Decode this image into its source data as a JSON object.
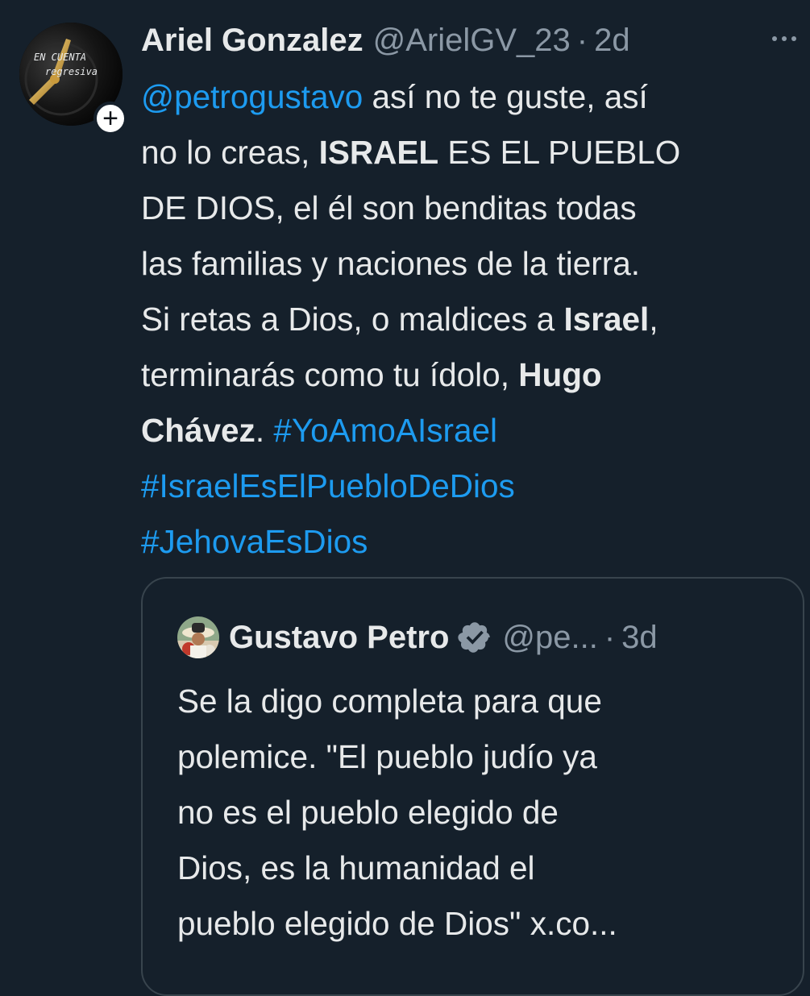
{
  "tweet": {
    "author_name": "Ariel Gonzalez",
    "author_handle": "@ArielGV_23",
    "separator": "·",
    "time": "2d",
    "avatar_text_line1": "EN CUENTA",
    "avatar_text_line2": "regresiva",
    "follow_symbol": "+",
    "lines": [
      [
        {
          "t": "@petrogustavo",
          "s": "link"
        },
        {
          "t": " así no te guste, así",
          "s": "normal"
        }
      ],
      [
        {
          "t": "no lo creas, ",
          "s": "normal"
        },
        {
          "t": "ISRAEL",
          "s": "bold"
        },
        {
          "t": " ES EL PUEBLO",
          "s": "normal"
        }
      ],
      [
        {
          "t": "DE DIOS, el él son benditas todas",
          "s": "normal"
        }
      ],
      [
        {
          "t": "las familias y naciones de la tierra.",
          "s": "normal"
        }
      ],
      [
        {
          "t": "Si retas a Dios, o maldices a ",
          "s": "normal"
        },
        {
          "t": "Israel",
          "s": "bold"
        },
        {
          "t": ",",
          "s": "normal"
        }
      ],
      [
        {
          "t": "terminarás como tu ídolo, ",
          "s": "normal"
        },
        {
          "t": "Hugo",
          "s": "bold"
        }
      ],
      [
        {
          "t": "Chávez",
          "s": "bold"
        },
        {
          "t": ".  ",
          "s": "normal"
        },
        {
          "t": "#YoAmoAIsrael",
          "s": "link"
        }
      ],
      [
        {
          "t": "#IsraelEsElPuebloDeDios",
          "s": "link"
        }
      ],
      [
        {
          "t": "#JehovaEsDios",
          "s": "link"
        }
      ]
    ]
  },
  "quoted": {
    "author_name": "Gustavo Petro",
    "author_handle": "@pe...",
    "separator": "·",
    "time": "3d",
    "lines": [
      "Se la digo completa para que",
      "polemice. \"El pueblo judío ya",
      "no es el pueblo elegido de",
      "Dios, es la humanidad el",
      "pueblo elegido de Dios\" x.co..."
    ]
  },
  "colors": {
    "background": "#15202b",
    "text": "#e7e9ea",
    "secondary": "#8b98a5",
    "link": "#1d9bf0",
    "border": "#38444d"
  },
  "icons": [
    "more-icon",
    "verified-badge-icon",
    "follow-plus-icon"
  ]
}
